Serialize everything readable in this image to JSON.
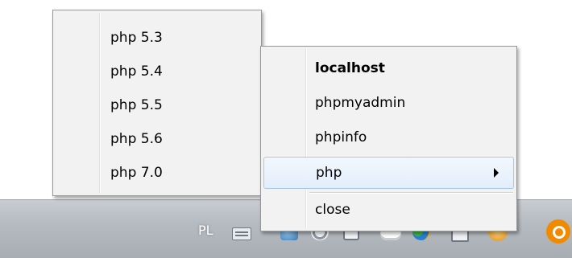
{
  "taskbar": {
    "language": "PL",
    "tray_icons": [
      "keyboard-icon",
      "network-icon",
      "sync-icon",
      "window-icon",
      "cloud-icon",
      "chrome-icon",
      "monitor-icon",
      "chat-icon",
      "wamp-icon"
    ]
  },
  "main_menu": {
    "items": [
      {
        "label": "localhost",
        "bold": true
      },
      {
        "label": "phpmyadmin"
      },
      {
        "label": "phpinfo"
      },
      {
        "label": "php",
        "has_submenu": true,
        "highlighted": true
      },
      {
        "label": "close"
      }
    ]
  },
  "php_submenu": {
    "items": [
      {
        "label": "php 5.3"
      },
      {
        "label": "php 5.4"
      },
      {
        "label": "php 5.5"
      },
      {
        "label": "php 5.6"
      },
      {
        "label": "php 7.0"
      }
    ]
  },
  "colors": {
    "menu_background": "#f2f2f2",
    "highlight_border": "#aac8ea"
  }
}
